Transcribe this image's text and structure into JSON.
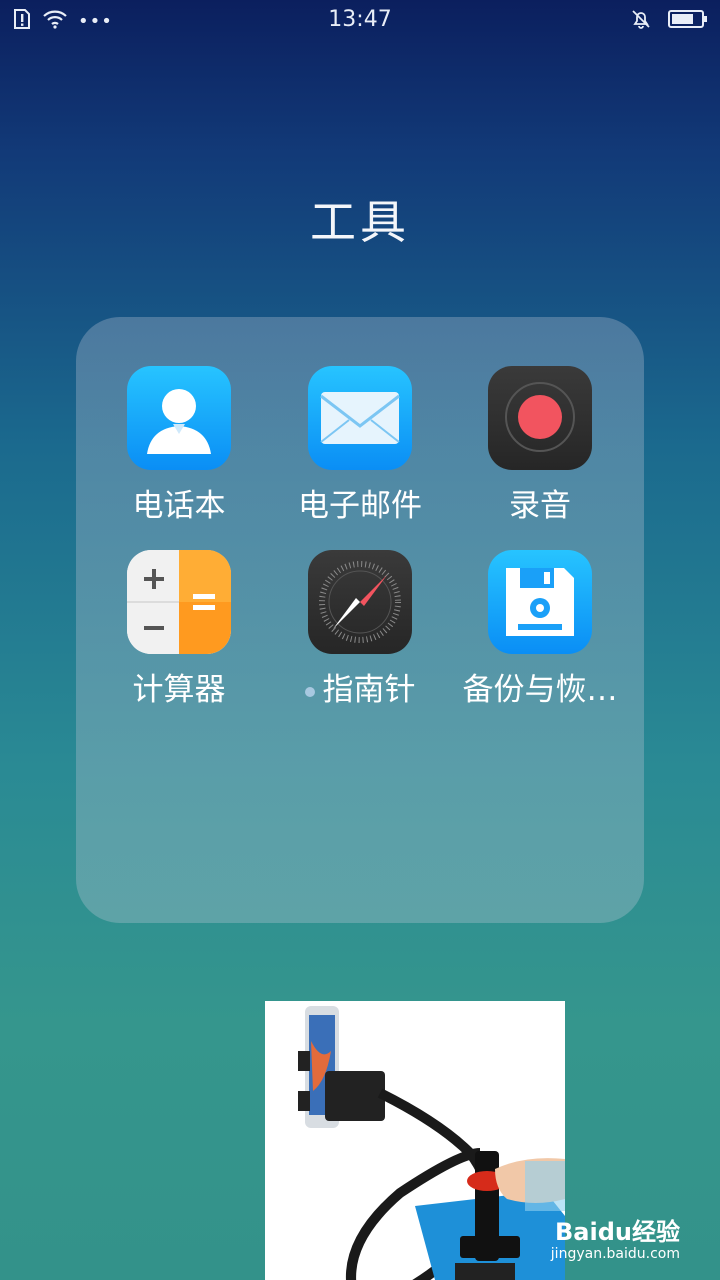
{
  "status_bar": {
    "time": "13:47",
    "more": "•••",
    "icons": [
      "sim-alert-icon",
      "wifi-icon",
      "bell-muted-icon",
      "battery-icon"
    ],
    "battery_level": 0.75
  },
  "folder": {
    "title": "工具",
    "apps": [
      {
        "label": "电话本",
        "icon": "contacts-icon"
      },
      {
        "label": "电子邮件",
        "icon": "mail-icon"
      },
      {
        "label": "录音",
        "icon": "recorder-icon"
      },
      {
        "label": "计算器",
        "icon": "calculator-icon"
      },
      {
        "label": "指南针",
        "icon": "compass-icon",
        "new_badge": true
      },
      {
        "label": "备份与恢…",
        "icon": "backup-icon"
      }
    ]
  },
  "overlay": {
    "watermark": "Baièå 经验",
    "watermark_text": "Baidu经验",
    "watermark_url": "jingyan.baidu.com"
  },
  "colors": {
    "accent_blue": "#1aa9ff",
    "record_red": "#f2545f",
    "calc_orange": "#ff9a1f"
  }
}
